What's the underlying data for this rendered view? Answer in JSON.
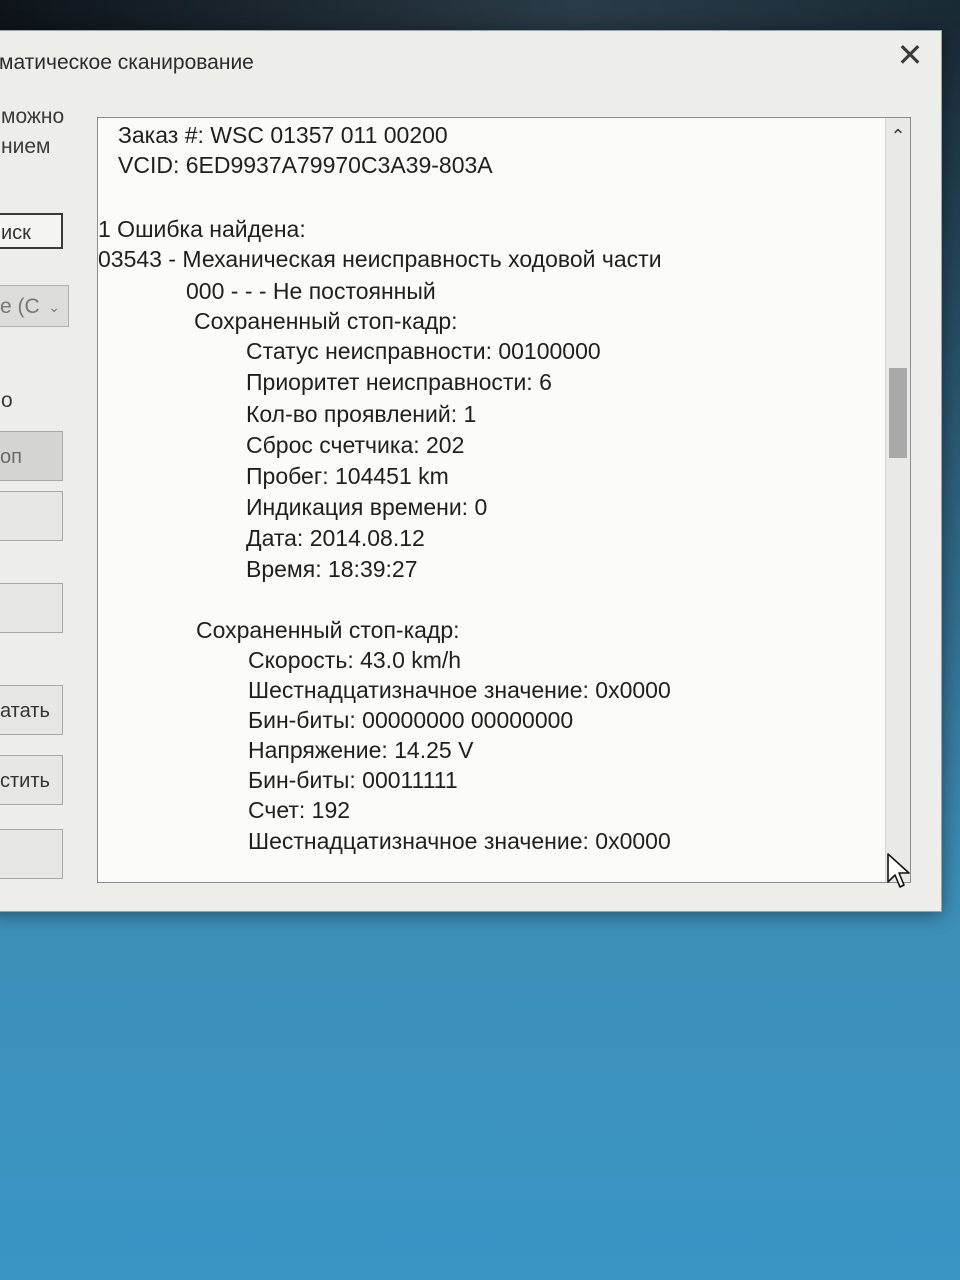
{
  "window": {
    "title": "матическое сканирование",
    "close_symbol": "✕"
  },
  "left_panel": {
    "text1": "можно",
    "text2": "нием",
    "search_button": "иск",
    "combo_value": "е (С",
    "text3": "о",
    "button_gray": "оп",
    "print_button": "атать",
    "clear_button": "стить"
  },
  "report": {
    "order": "Заказ #: WSC 01357 011 00200",
    "vcid": "VCID: 6ED9937A79970C3A39-803A",
    "errors_found": "1 Ошибка найдена:",
    "fault_code": "03543 - Механическая неисправность ходовой части",
    "fault_sub": "000 - - - Не постоянный",
    "freeze1": {
      "header": "Сохраненный стоп-кадр:",
      "status": "Статус неисправности: 00100000",
      "priority": "Приоритет неисправности: 6",
      "count": "Кол-во проявлений: 1",
      "reset": "Сброс счетчика: 202",
      "mileage": "Пробег: 104451 km",
      "time_ind": "Индикация времени: 0",
      "date": "Дата: 2014.08.12",
      "time": "Время: 18:39:27"
    },
    "freeze2": {
      "header": "Сохраненный стоп-кадр:",
      "speed": "Скорость: 43.0 km/h",
      "hex1": "Шестнадцатизначное значение: 0x0000",
      "bin1": "Бин-биты: 00000000 00000000",
      "voltage": "Напряжение: 14.25 V",
      "bin2": "Бин-биты: 00011111",
      "counter": "Счет: 192",
      "hex2": "Шестнадцатизначное значение: 0x0000"
    }
  },
  "scrollbar": {
    "up_symbol": "⌃",
    "down_symbol": "⌄"
  }
}
